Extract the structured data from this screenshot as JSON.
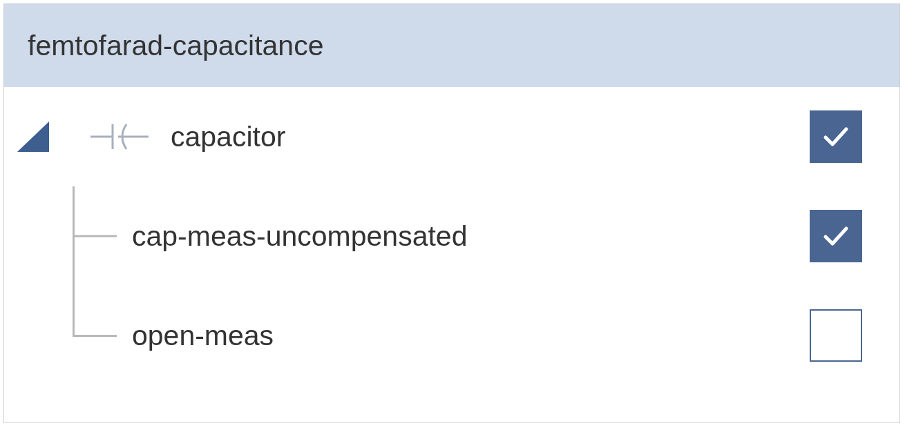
{
  "panel": {
    "title": "femtofarad-capacitance"
  },
  "tree": [
    {
      "label": "capacitor",
      "expanded": true,
      "checked": true,
      "children": [
        {
          "label": "cap-meas-uncompensated",
          "checked": true
        },
        {
          "label": "open-meas",
          "checked": false
        }
      ]
    }
  ]
}
